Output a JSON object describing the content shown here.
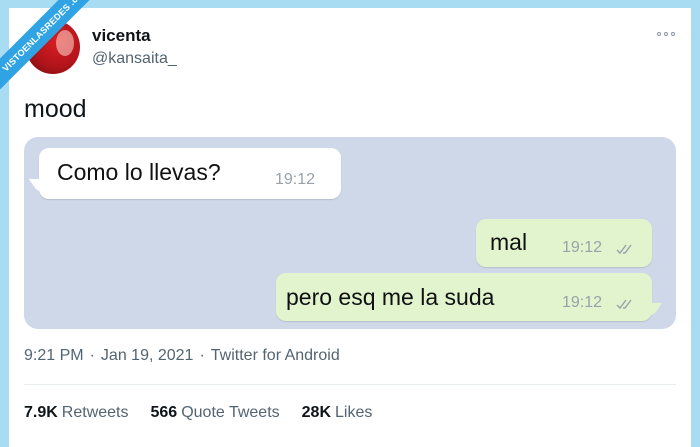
{
  "watermark": "VISTOENLASREDES .com",
  "author": {
    "display_name": "vicenta",
    "handle": "@kansaita_"
  },
  "tweet": {
    "text": "mood",
    "timestamp": "9:21 PM",
    "date": "Jan 19, 2021",
    "separator": "·",
    "source": "Twitter for Android"
  },
  "chat": {
    "messages": [
      {
        "direction": "incoming",
        "text": "Como lo llevas?",
        "time": "19:12"
      },
      {
        "direction": "outgoing",
        "text": "mal",
        "time": "19:12",
        "status": "read"
      },
      {
        "direction": "outgoing",
        "text": "pero esq me la suda",
        "time": "19:12",
        "status": "read"
      }
    ],
    "colors": {
      "background": "#cfd8e8",
      "incoming": "#ffffff",
      "outgoing": "#e1f4cd",
      "ticks": "#9aa1a9"
    }
  },
  "stats": [
    {
      "count": "7.9K",
      "label": "Retweets"
    },
    {
      "count": "566",
      "label": "Quote Tweets"
    },
    {
      "count": "28K",
      "label": "Likes"
    }
  ],
  "icons": [
    "more-icon",
    "double-check-icon"
  ]
}
